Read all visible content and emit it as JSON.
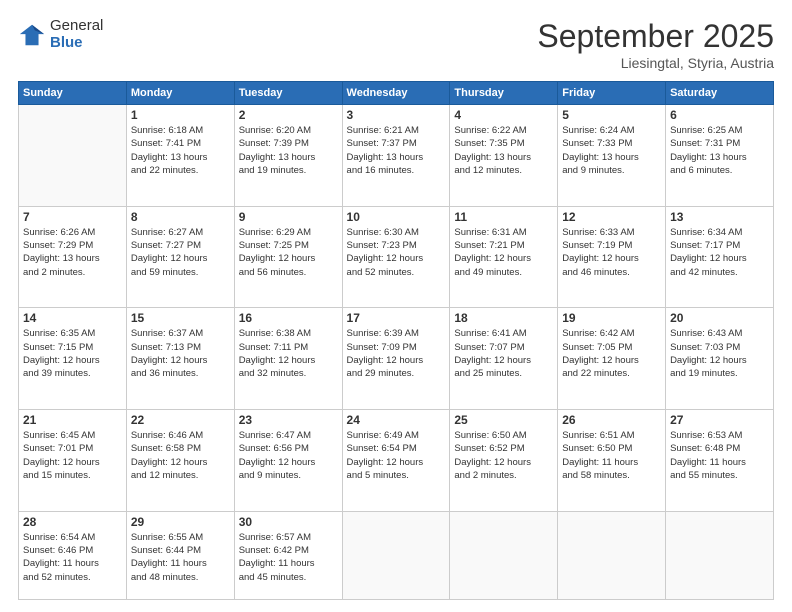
{
  "header": {
    "logo": {
      "general": "General",
      "blue": "Blue"
    },
    "title": "September 2025",
    "location": "Liesingtal, Styria, Austria"
  },
  "weekdays": [
    "Sunday",
    "Monday",
    "Tuesday",
    "Wednesday",
    "Thursday",
    "Friday",
    "Saturday"
  ],
  "weeks": [
    [
      {
        "day": null,
        "info": null
      },
      {
        "day": "1",
        "info": "Sunrise: 6:18 AM\nSunset: 7:41 PM\nDaylight: 13 hours\nand 22 minutes."
      },
      {
        "day": "2",
        "info": "Sunrise: 6:20 AM\nSunset: 7:39 PM\nDaylight: 13 hours\nand 19 minutes."
      },
      {
        "day": "3",
        "info": "Sunrise: 6:21 AM\nSunset: 7:37 PM\nDaylight: 13 hours\nand 16 minutes."
      },
      {
        "day": "4",
        "info": "Sunrise: 6:22 AM\nSunset: 7:35 PM\nDaylight: 13 hours\nand 12 minutes."
      },
      {
        "day": "5",
        "info": "Sunrise: 6:24 AM\nSunset: 7:33 PM\nDaylight: 13 hours\nand 9 minutes."
      },
      {
        "day": "6",
        "info": "Sunrise: 6:25 AM\nSunset: 7:31 PM\nDaylight: 13 hours\nand 6 minutes."
      }
    ],
    [
      {
        "day": "7",
        "info": "Sunrise: 6:26 AM\nSunset: 7:29 PM\nDaylight: 13 hours\nand 2 minutes."
      },
      {
        "day": "8",
        "info": "Sunrise: 6:27 AM\nSunset: 7:27 PM\nDaylight: 12 hours\nand 59 minutes."
      },
      {
        "day": "9",
        "info": "Sunrise: 6:29 AM\nSunset: 7:25 PM\nDaylight: 12 hours\nand 56 minutes."
      },
      {
        "day": "10",
        "info": "Sunrise: 6:30 AM\nSunset: 7:23 PM\nDaylight: 12 hours\nand 52 minutes."
      },
      {
        "day": "11",
        "info": "Sunrise: 6:31 AM\nSunset: 7:21 PM\nDaylight: 12 hours\nand 49 minutes."
      },
      {
        "day": "12",
        "info": "Sunrise: 6:33 AM\nSunset: 7:19 PM\nDaylight: 12 hours\nand 46 minutes."
      },
      {
        "day": "13",
        "info": "Sunrise: 6:34 AM\nSunset: 7:17 PM\nDaylight: 12 hours\nand 42 minutes."
      }
    ],
    [
      {
        "day": "14",
        "info": "Sunrise: 6:35 AM\nSunset: 7:15 PM\nDaylight: 12 hours\nand 39 minutes."
      },
      {
        "day": "15",
        "info": "Sunrise: 6:37 AM\nSunset: 7:13 PM\nDaylight: 12 hours\nand 36 minutes."
      },
      {
        "day": "16",
        "info": "Sunrise: 6:38 AM\nSunset: 7:11 PM\nDaylight: 12 hours\nand 32 minutes."
      },
      {
        "day": "17",
        "info": "Sunrise: 6:39 AM\nSunset: 7:09 PM\nDaylight: 12 hours\nand 29 minutes."
      },
      {
        "day": "18",
        "info": "Sunrise: 6:41 AM\nSunset: 7:07 PM\nDaylight: 12 hours\nand 25 minutes."
      },
      {
        "day": "19",
        "info": "Sunrise: 6:42 AM\nSunset: 7:05 PM\nDaylight: 12 hours\nand 22 minutes."
      },
      {
        "day": "20",
        "info": "Sunrise: 6:43 AM\nSunset: 7:03 PM\nDaylight: 12 hours\nand 19 minutes."
      }
    ],
    [
      {
        "day": "21",
        "info": "Sunrise: 6:45 AM\nSunset: 7:01 PM\nDaylight: 12 hours\nand 15 minutes."
      },
      {
        "day": "22",
        "info": "Sunrise: 6:46 AM\nSunset: 6:58 PM\nDaylight: 12 hours\nand 12 minutes."
      },
      {
        "day": "23",
        "info": "Sunrise: 6:47 AM\nSunset: 6:56 PM\nDaylight: 12 hours\nand 9 minutes."
      },
      {
        "day": "24",
        "info": "Sunrise: 6:49 AM\nSunset: 6:54 PM\nDaylight: 12 hours\nand 5 minutes."
      },
      {
        "day": "25",
        "info": "Sunrise: 6:50 AM\nSunset: 6:52 PM\nDaylight: 12 hours\nand 2 minutes."
      },
      {
        "day": "26",
        "info": "Sunrise: 6:51 AM\nSunset: 6:50 PM\nDaylight: 11 hours\nand 58 minutes."
      },
      {
        "day": "27",
        "info": "Sunrise: 6:53 AM\nSunset: 6:48 PM\nDaylight: 11 hours\nand 55 minutes."
      }
    ],
    [
      {
        "day": "28",
        "info": "Sunrise: 6:54 AM\nSunset: 6:46 PM\nDaylight: 11 hours\nand 52 minutes."
      },
      {
        "day": "29",
        "info": "Sunrise: 6:55 AM\nSunset: 6:44 PM\nDaylight: 11 hours\nand 48 minutes."
      },
      {
        "day": "30",
        "info": "Sunrise: 6:57 AM\nSunset: 6:42 PM\nDaylight: 11 hours\nand 45 minutes."
      },
      {
        "day": null,
        "info": null
      },
      {
        "day": null,
        "info": null
      },
      {
        "day": null,
        "info": null
      },
      {
        "day": null,
        "info": null
      }
    ]
  ]
}
